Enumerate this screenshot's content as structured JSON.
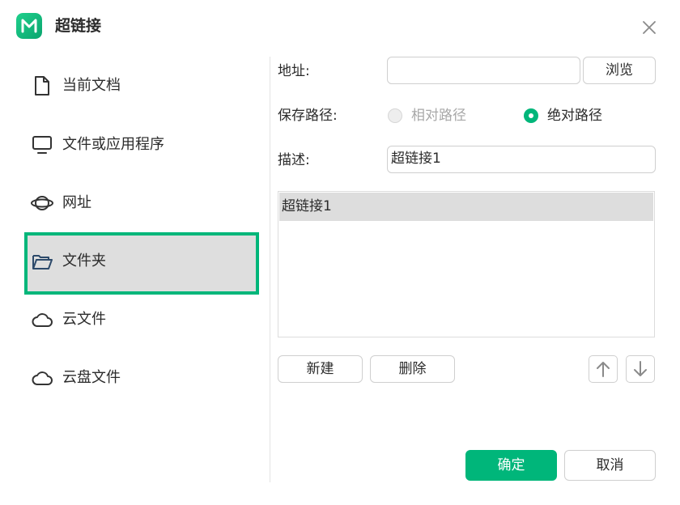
{
  "dialog": {
    "title": "超链接"
  },
  "sidebar": {
    "items": [
      {
        "label": "当前文档",
        "icon": "document-icon",
        "active": false
      },
      {
        "label": "文件或应用程序",
        "icon": "monitor-icon",
        "active": false
      },
      {
        "label": "网址",
        "icon": "globe-icon",
        "active": false
      },
      {
        "label": "文件夹",
        "icon": "folder-icon",
        "active": true
      },
      {
        "label": "云文件",
        "icon": "cloud-icon",
        "active": false
      },
      {
        "label": "云盘文件",
        "icon": "cloud-drive-icon",
        "active": false
      }
    ]
  },
  "form": {
    "address_label": "地址:",
    "address_value": "",
    "browse_label": "浏览",
    "save_path_label": "保存路径:",
    "relative_label": "相对路径",
    "absolute_label": "绝对路径",
    "selected_path_mode": "absolute",
    "description_label": "描述:",
    "description_value": "超链接1"
  },
  "list": {
    "items": [
      "超链接1"
    ],
    "selected_index": 0
  },
  "list_actions": {
    "new_label": "新建",
    "delete_label": "删除"
  },
  "footer": {
    "ok_label": "确定",
    "cancel_label": "取消"
  },
  "colors": {
    "accent": "#00b67a",
    "selected_bg": "#dddddd",
    "icon_dark": "#2d4a6b"
  }
}
